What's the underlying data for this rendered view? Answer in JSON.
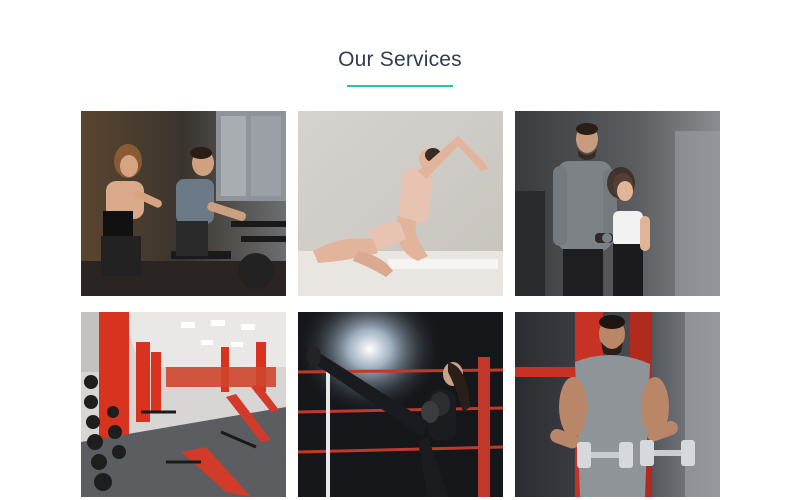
{
  "section": {
    "title": "Our Services",
    "accent_color": "#1ec6a8"
  },
  "services": [
    {
      "id": "spin-cycling",
      "icon": "cycling-photo"
    },
    {
      "id": "yoga-stretching",
      "icon": "yoga-photo"
    },
    {
      "id": "personal-training",
      "icon": "trainer-photo"
    },
    {
      "id": "gym-floor",
      "icon": "gym-photo"
    },
    {
      "id": "kickboxing",
      "icon": "kickboxing-photo"
    },
    {
      "id": "weight-training",
      "icon": "dumbbell-photo"
    }
  ]
}
